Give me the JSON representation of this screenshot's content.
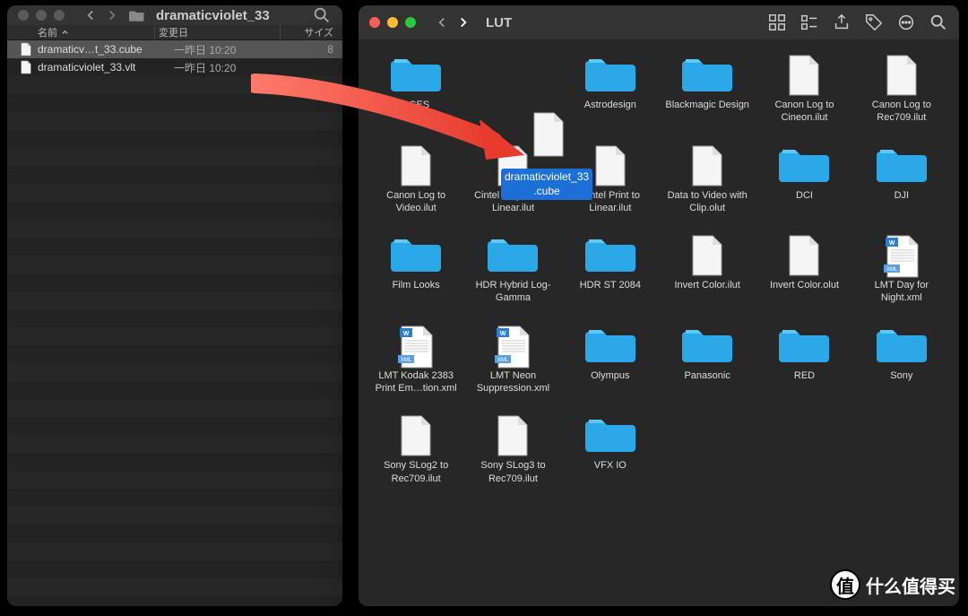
{
  "left": {
    "title": "dramaticviolet_33",
    "columns": {
      "name": "名前",
      "modified": "変更日",
      "size": "サイズ"
    },
    "rows": [
      {
        "name": "dramaticv…t_33.cube",
        "modified": "一昨日 10:20",
        "size": "8",
        "selected": true
      },
      {
        "name": "dramaticviolet_33.vlt",
        "modified": "一昨日 10:20",
        "size": "",
        "selected": false
      }
    ]
  },
  "right": {
    "title": "LUT",
    "drag_label": "dramaticviolet_33\n.cube",
    "items": [
      {
        "name": "ACES",
        "type": "folder"
      },
      {
        "name": "",
        "type": "skip"
      },
      {
        "name": "Astrodesign",
        "type": "folder"
      },
      {
        "name": "Blackmagic Design",
        "type": "folder"
      },
      {
        "name": "Canon Log to Cineon.ilut",
        "type": "file"
      },
      {
        "name": "Canon Log to Rec709.ilut",
        "type": "file"
      },
      {
        "name": "Canon Log to Video.ilut",
        "type": "file"
      },
      {
        "name": "Cintel Negative to Linear.ilut",
        "type": "file"
      },
      {
        "name": "Cintel Print to Linear.ilut",
        "type": "file"
      },
      {
        "name": "Data to Video with Clip.olut",
        "type": "file"
      },
      {
        "name": "DCI",
        "type": "folder"
      },
      {
        "name": "DJI",
        "type": "folder"
      },
      {
        "name": "Film Looks",
        "type": "folder"
      },
      {
        "name": "HDR Hybrid Log-Gamma",
        "type": "folder"
      },
      {
        "name": "HDR ST 2084",
        "type": "folder"
      },
      {
        "name": "Invert Color.ilut",
        "type": "file"
      },
      {
        "name": "Invert Color.olut",
        "type": "file"
      },
      {
        "name": "LMT Day for Night.xml",
        "type": "xml"
      },
      {
        "name": "LMT Kodak 2383 Print Em…tion.xml",
        "type": "xml"
      },
      {
        "name": "LMT Neon Suppression.xml",
        "type": "xml"
      },
      {
        "name": "Olympus",
        "type": "folder"
      },
      {
        "name": "Panasonic",
        "type": "folder"
      },
      {
        "name": "RED",
        "type": "folder"
      },
      {
        "name": "Sony",
        "type": "folder"
      },
      {
        "name": "Sony SLog2 to Rec709.ilut",
        "type": "file"
      },
      {
        "name": "Sony SLog3 to Rec709.ilut",
        "type": "file"
      },
      {
        "name": "VFX IO",
        "type": "folder"
      }
    ]
  },
  "watermark": "什么值得买"
}
